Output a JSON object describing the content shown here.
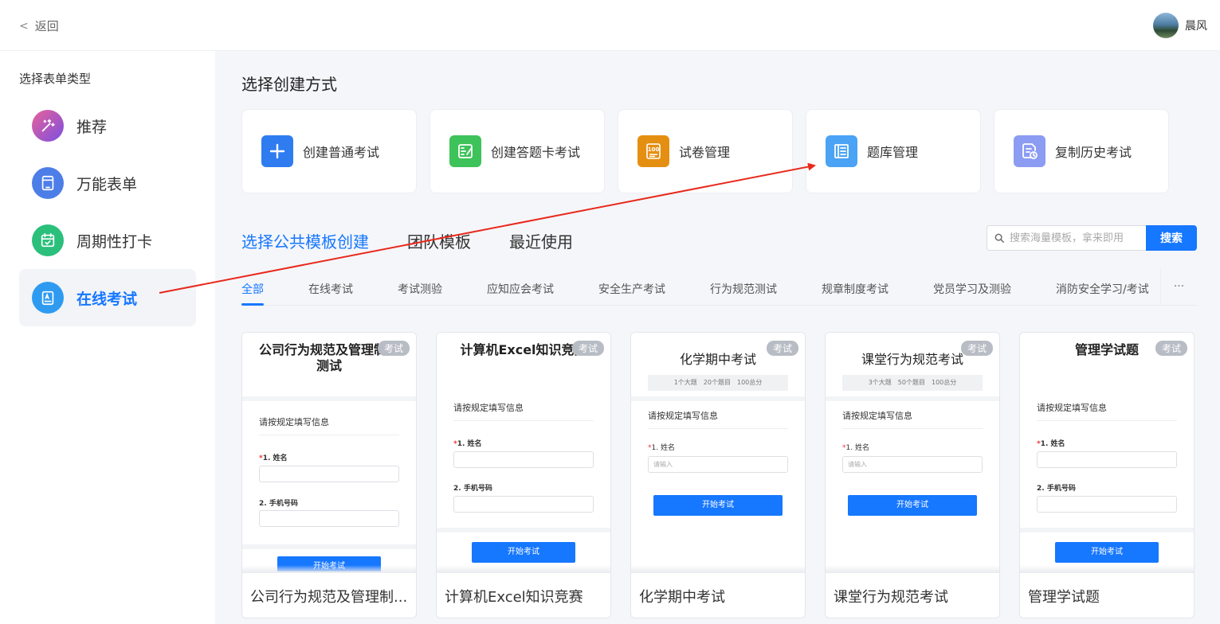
{
  "header": {
    "back_label": "返回",
    "user_name": "晨风"
  },
  "sidebar": {
    "title": "选择表单类型",
    "items": [
      {
        "label": "推荐",
        "icon": "magic-wand-icon",
        "color": "#b455d6"
      },
      {
        "label": "万能表单",
        "icon": "form-icon",
        "color": "#4d7ee8"
      },
      {
        "label": "周期性打卡",
        "icon": "calendar-check-icon",
        "color": "#2bbf7c"
      },
      {
        "label": "在线考试",
        "icon": "exam-icon",
        "color": "#2f9bf0"
      }
    ],
    "active_index": 3
  },
  "main": {
    "title": "选择创建方式",
    "methods": [
      {
        "label": "创建普通考试",
        "icon": "plus-icon",
        "color": "#2f7cf0"
      },
      {
        "label": "创建答题卡考试",
        "icon": "answer-sheet-icon",
        "color": "#3ec25a"
      },
      {
        "label": "试卷管理",
        "icon": "paper-score-icon",
        "color": "#e58f12"
      },
      {
        "label": "题库管理",
        "icon": "question-bank-icon",
        "color": "#4aa3f5"
      },
      {
        "label": "复制历史考试",
        "icon": "copy-history-icon",
        "color": "#8c9cf3"
      }
    ]
  },
  "templates": {
    "tabs": [
      "选择公共模板创建",
      "团队模板",
      "最近使用"
    ],
    "active_tab": 0,
    "search_placeholder": "搜索海量模板，拿来即用",
    "search_button": "搜索",
    "categories": [
      "全部",
      "在线考试",
      "考试测验",
      "应知应会考试",
      "安全生产考试",
      "行为规范测试",
      "规章制度考试",
      "党员学习及测验",
      "消防安全学习/考试"
    ],
    "more_label": "···",
    "cards": [
      {
        "title": "公司行为规范及管理制度测试",
        "name": "公司行为规范及管理制...",
        "badge": "考试",
        "section": "请按规定填写信息",
        "field1": "1. 姓名",
        "field2": "2. 手机号码",
        "button": "开始考试"
      },
      {
        "title": "计算机Excel知识竞赛",
        "name": "计算机Excel知识竞赛",
        "badge": "考试",
        "section": "请按规定填写信息",
        "field1": "1. 姓名",
        "field2": "2. 手机号码",
        "button": "开始考试"
      },
      {
        "title": "化学期中考试",
        "name": "化学期中考试",
        "badge": "考试",
        "info": "1个大题　20个题目　100总分",
        "section": "请按规定填写信息",
        "field1": "1. 姓名",
        "placeholder": "请输入",
        "button": "开始考试"
      },
      {
        "title": "课堂行为规范考试",
        "name": "课堂行为规范考试",
        "badge": "考试",
        "info": "3个大题　50个题目　100总分",
        "section": "请按规定填写信息",
        "field1": "1. 姓名",
        "placeholder": "请输入",
        "button": "开始考试"
      },
      {
        "title": "管理学试题",
        "name": "管理学试题",
        "badge": "考试",
        "section": "请按规定填写信息",
        "field1": "1. 姓名",
        "field2": "2. 手机号码",
        "button": "开始考试"
      }
    ]
  },
  "colors": {
    "accent": "#1677ff",
    "annotation_arrow": "#e8291c"
  }
}
